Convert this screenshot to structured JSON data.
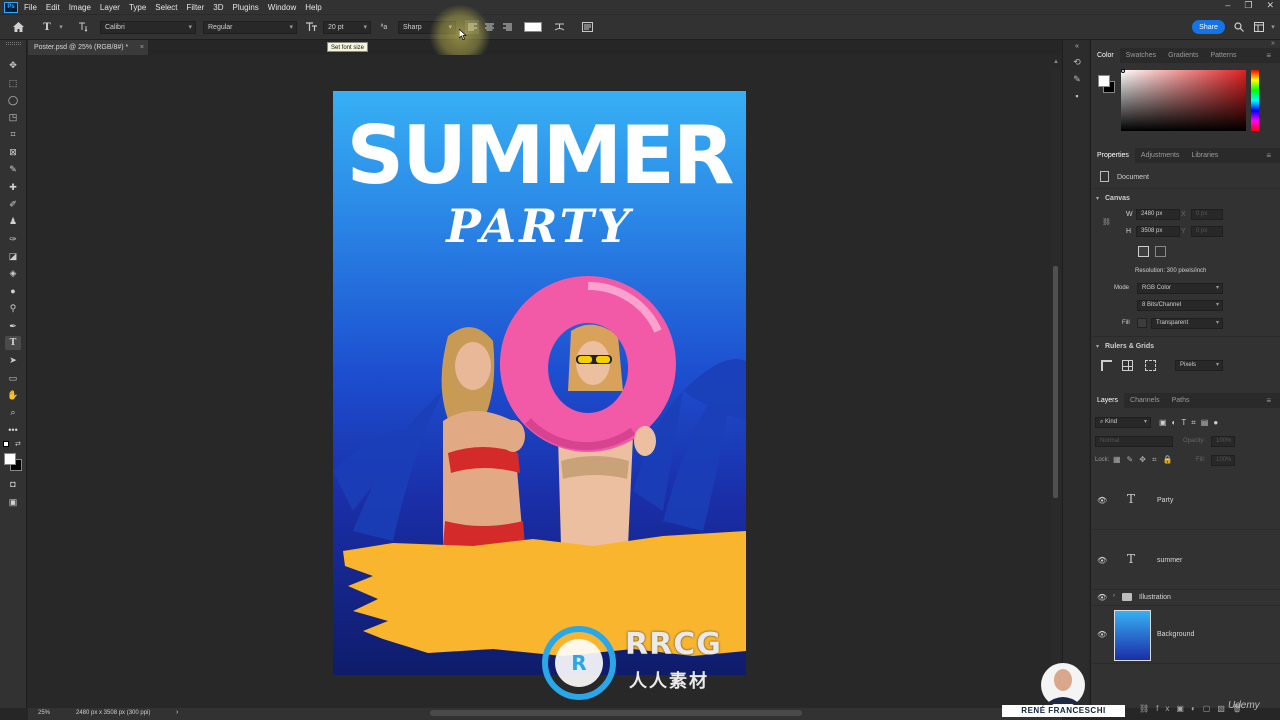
{
  "app": {
    "logo": "Ps",
    "menu": [
      "File",
      "Edit",
      "Image",
      "Layer",
      "Type",
      "Select",
      "Filter",
      "3D",
      "Plugins",
      "Window",
      "Help"
    ],
    "window_controls": [
      "–",
      "❐",
      "✕"
    ]
  },
  "options_bar": {
    "tool_glyph": "T",
    "font_family": "Calibri",
    "font_style": "Regular",
    "font_size": "20 pt",
    "antialias": "Sharp",
    "share_label": "Share",
    "tooltip": "Set font size"
  },
  "document": {
    "tab_title": "Poster.psd @ 25% (RGB/8#) *",
    "close": "×"
  },
  "poster": {
    "title": "SUMMER",
    "subtitle": "PARTY",
    "background_top": "#37b0f4",
    "background_bottom": "#0f1c6a",
    "ring_color": "#f25aa8",
    "brush_color": "#f9b52e"
  },
  "status": {
    "zoom": "25%",
    "doc_info": "2480 px x 3508 px (300 ppi)",
    "arrow": "›"
  },
  "color_panel": {
    "tabs": [
      "Color",
      "Swatches",
      "Gradients",
      "Patterns"
    ],
    "active_hue": "#e02020"
  },
  "properties_panel": {
    "tabs": [
      "Properties",
      "Adjustments",
      "Libraries"
    ],
    "doc_label": "Document",
    "canvas_section": "Canvas",
    "w_label": "W",
    "w_value": "2480 px",
    "h_label": "H",
    "h_value": "3508 px",
    "x_label": "X",
    "x_value": "0 px",
    "y_label": "Y",
    "y_value": "0 px",
    "resolution": "Resolution: 300 pixels/inch",
    "mode_label": "Mode",
    "mode_value": "RGB Color",
    "bits_value": "8 Bits/Channel",
    "fill_label": "Fill",
    "fill_value": "Transparent",
    "rulers_section": "Rulers & Grids",
    "units_value": "Pixels"
  },
  "layers_panel": {
    "tabs": [
      "Layers",
      "Channels",
      "Paths"
    ],
    "kind_label": "Kind",
    "blend_mode": "Normal",
    "opacity_label": "Opacity:",
    "opacity_value": "100%",
    "lock_label": "Lock:",
    "fill_label": "Fill:",
    "fill_value": "100%",
    "layers": [
      {
        "name": "Party",
        "type": "text"
      },
      {
        "name": "summer",
        "type": "text"
      },
      {
        "name": "Illustration",
        "type": "group"
      },
      {
        "name": "Background",
        "type": "image"
      }
    ]
  },
  "overlay": {
    "watermark_big": "RRCG",
    "watermark_small": "人人素材",
    "presenter_name": "RENÉ FRANCESCHI",
    "udemy": "Udemy"
  }
}
